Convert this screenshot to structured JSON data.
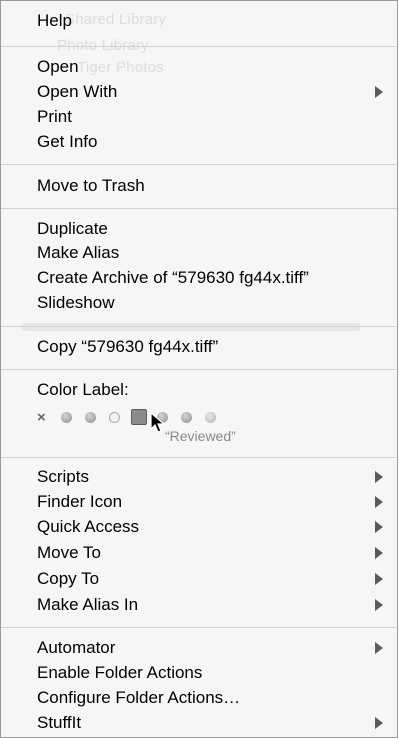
{
  "menu": {
    "background_ghost": [
      "Shared Library",
      "Photo Library",
      "Tiger Photos"
    ],
    "groups": [
      {
        "items": [
          {
            "label": "Help",
            "submenu": false
          }
        ]
      },
      {
        "items": [
          {
            "label": "Open",
            "submenu": false
          },
          {
            "label": "Open With",
            "submenu": true
          },
          {
            "label": "Print",
            "submenu": false
          },
          {
            "label": "Get Info",
            "submenu": false
          }
        ]
      },
      {
        "items": [
          {
            "label": "Move to Trash",
            "submenu": false
          }
        ]
      },
      {
        "items": [
          {
            "label": "Duplicate",
            "submenu": false
          },
          {
            "label": "Make Alias",
            "submenu": false
          },
          {
            "label": "Create Archive of “579630 fg44x.tiff”",
            "submenu": false
          },
          {
            "label": "Slideshow",
            "submenu": false
          }
        ]
      },
      {
        "items": [
          {
            "label": "Copy “579630 fg44x.tiff”",
            "submenu": false
          }
        ]
      },
      {
        "items": [
          {
            "label": "Scripts",
            "submenu": true
          },
          {
            "label": "Finder Icon",
            "submenu": true
          },
          {
            "label": "Quick Access",
            "submenu": true
          },
          {
            "label": "Move To",
            "submenu": true
          },
          {
            "label": "Copy To",
            "submenu": true
          },
          {
            "label": "Make Alias In",
            "submenu": true
          }
        ]
      },
      {
        "items": [
          {
            "label": "Automator",
            "submenu": true
          },
          {
            "label": "Enable Folder Actions",
            "submenu": false
          },
          {
            "label": "Configure Folder Actions…",
            "submenu": false
          },
          {
            "label": "StuffIt",
            "submenu": true
          }
        ]
      }
    ],
    "color_label": {
      "title": "Color Label:",
      "clear_symbol": "×",
      "hover_name": "“Reviewed”",
      "selected_index": 3,
      "swatches": [
        "gray",
        "gray",
        "ring",
        "selected",
        "gray",
        "gray",
        "lite"
      ]
    }
  }
}
